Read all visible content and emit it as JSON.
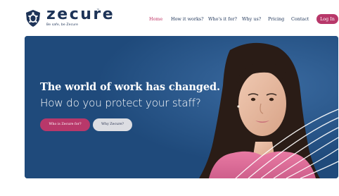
{
  "brand": {
    "name": "zecure",
    "trademark": "™",
    "tagline": "Be safe, be Zecure",
    "logo_icon": "turtle-shield-icon",
    "primary_color": "#1d3357",
    "accent_color": "#b8386a"
  },
  "nav": {
    "items": [
      {
        "label": "Home",
        "active": true
      },
      {
        "label": "How it works?",
        "active": false
      },
      {
        "label": "Who's it for?",
        "active": false
      },
      {
        "label": "Why us?",
        "active": false
      },
      {
        "label": "Pricing",
        "active": false
      },
      {
        "label": "Contact",
        "active": false
      }
    ],
    "login_label": "Log In"
  },
  "hero": {
    "title": "The world of work has changed.",
    "subtitle": "How do you protect your staff?",
    "primary_button": "Who is Zecure for?",
    "secondary_button": "Why Zecure?",
    "background_color": "#1f4a7b"
  }
}
